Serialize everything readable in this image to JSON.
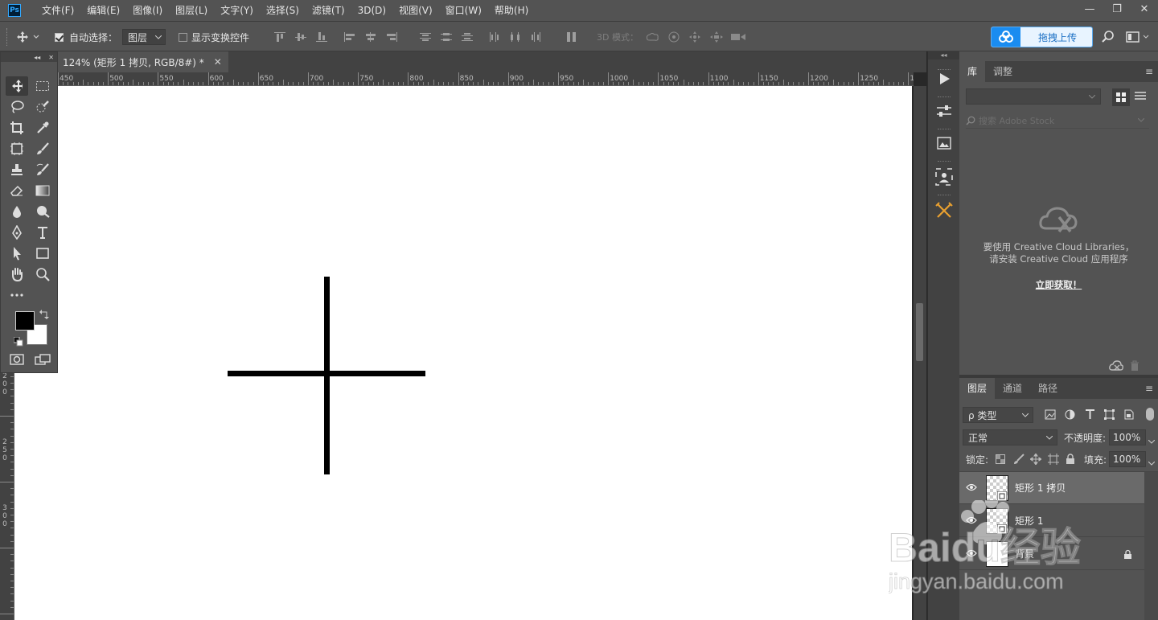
{
  "app": {
    "logo": "Ps"
  },
  "menu": [
    "文件(F)",
    "编辑(E)",
    "图像(I)",
    "图层(L)",
    "文字(Y)",
    "选择(S)",
    "滤镜(T)",
    "3D(D)",
    "视图(V)",
    "窗口(W)",
    "帮助(H)"
  ],
  "window_controls": {
    "minimize": "—",
    "restore": "❐",
    "close": "✕"
  },
  "options": {
    "auto_select_label": "自动选择：",
    "auto_select_checked": true,
    "auto_select_target": "图层",
    "show_transform_label": "显示变换控件",
    "show_transform_checked": false,
    "mode_3d_label": "3D 模式：",
    "upload_button": "拖拽上传"
  },
  "document": {
    "tab_title": "124% (矩形 1 拷贝, RGB/8#) *",
    "close": "✕"
  },
  "ruler": {
    "h_labels": [
      "450",
      "500",
      "550",
      "600",
      "650",
      "700",
      "750",
      "800",
      "850",
      "900",
      "950",
      "1000",
      "1050",
      "1100",
      "1150",
      "1200",
      "1250",
      "13"
    ],
    "v_labels": [
      {
        "digits": [
          "1",
          "5",
          "0"
        ]
      },
      {
        "digits": [
          "2",
          "0",
          "0"
        ]
      },
      {
        "digits": [
          "2",
          "5",
          "0"
        ]
      },
      {
        "digits": [
          "3",
          "0",
          "0"
        ]
      }
    ]
  },
  "libraries": {
    "tabs": [
      "库",
      "调整"
    ],
    "search_placeholder": "搜索 Adobe Stock",
    "message_line1": "要使用 Creative Cloud Libraries，",
    "message_line2": "请安装 Creative Cloud 应用程序",
    "link": "立即获取！"
  },
  "layers_panel": {
    "tabs": [
      "图层",
      "通道",
      "路径"
    ],
    "filter_label": "ρ 类型",
    "blend_mode": "正常",
    "opacity_label": "不透明度:",
    "opacity_value": "100%",
    "lock_label": "锁定:",
    "fill_label": "填充:",
    "fill_value": "100%",
    "layers": [
      {
        "name": "矩形 1 拷贝",
        "selected": true,
        "visible": true,
        "locked": false
      },
      {
        "name": "矩形 1",
        "selected": false,
        "visible": true,
        "locked": false
      },
      {
        "name": "背景",
        "selected": false,
        "visible": true,
        "locked": true
      }
    ]
  },
  "watermark": {
    "brand": "Baidu经验",
    "url": "jingyan.baidu.com"
  },
  "colors": {
    "foreground": "#000000",
    "background": "#ffffff",
    "accent": "#1a8cf0"
  }
}
